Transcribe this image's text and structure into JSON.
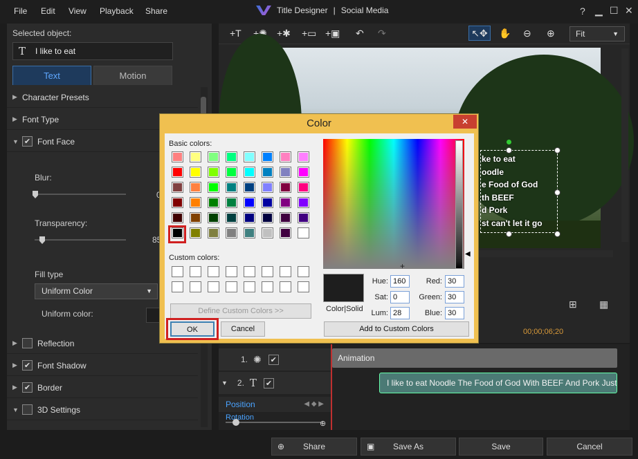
{
  "menu": {
    "file": "File",
    "edit": "Edit",
    "view": "View",
    "playback": "Playback",
    "share": "Share"
  },
  "window": {
    "title": "Title Designer",
    "separator": "|",
    "subtitle": "Social Media",
    "help": "?"
  },
  "left": {
    "selected_label": "Selected object:",
    "selected_value": "I like to eat",
    "tab_text": "Text",
    "tab_motion": "Motion",
    "character_presets": "Character Presets",
    "font_type": "Font Type",
    "font_face": "Font Face",
    "blur": "Blur:",
    "blur_value": "0",
    "transparency": "Transparency:",
    "transparency_value": "85",
    "fill_type": "Fill type",
    "fill_value": "Uniform Color",
    "uniform_color": "Uniform color:",
    "reflection": "Reflection",
    "font_shadow": "Font Shadow",
    "border": "Border",
    "settings_3d": "3D Settings"
  },
  "toolbar": {
    "fit": "Fit"
  },
  "preview": {
    "lines": [
      "ke to eat",
      "oodle",
      "e Food of God",
      "th BEEF",
      "d Pork",
      "st can't let it go"
    ]
  },
  "timeline": {
    "time": "00;00;06;20",
    "track1_num": "1.",
    "track2_num": "2.",
    "anim_label": "Animation",
    "text_clip": "I like to eat Noodle The Food of God With BEEF And Pork Just c",
    "position": "Position",
    "rotation": "Rotation"
  },
  "bottom": {
    "share": "Share",
    "save_as": "Save As",
    "save": "Save",
    "cancel": "Cancel"
  },
  "dialog": {
    "title": "Color",
    "close": "✕",
    "basic_label": "Basic colors:",
    "custom_label": "Custom colors:",
    "define_btn": "Define Custom Colors >>",
    "ok": "OK",
    "cancel": "Cancel",
    "color_solid": "Color|Solid",
    "hue_label": "Hue:",
    "hue": "160",
    "sat_label": "Sat:",
    "sat": "0",
    "lum_label": "Lum:",
    "lum": "28",
    "red_label": "Red:",
    "red": "30",
    "green_label": "Green:",
    "green": "30",
    "blue_label": "Blue:",
    "blue": "30",
    "add_custom": "Add to Custom Colors",
    "basic_colors": [
      "#ff8080",
      "#ffff80",
      "#80ff80",
      "#00ff80",
      "#80ffff",
      "#0080ff",
      "#ff80c0",
      "#ff80ff",
      "#ff0000",
      "#ffff00",
      "#80ff00",
      "#00ff40",
      "#00ffff",
      "#0080c0",
      "#8080c0",
      "#ff00ff",
      "#804040",
      "#ff8040",
      "#00ff00",
      "#008080",
      "#004080",
      "#8080ff",
      "#800040",
      "#ff0080",
      "#800000",
      "#ff8000",
      "#008000",
      "#008040",
      "#0000ff",
      "#0000a0",
      "#800080",
      "#8000ff",
      "#400000",
      "#804000",
      "#004000",
      "#004040",
      "#000080",
      "#000040",
      "#400040",
      "#400080",
      "#000000",
      "#808000",
      "#808040",
      "#808080",
      "#408080",
      "#c0c0c0",
      "#400040",
      "#ffffff"
    ]
  }
}
